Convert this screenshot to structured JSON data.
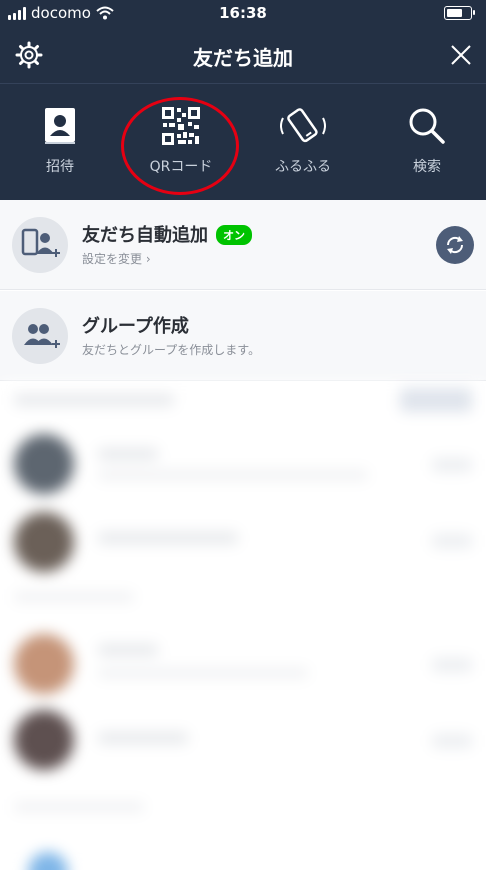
{
  "status_bar": {
    "carrier": "docomo",
    "time": "16:38"
  },
  "header": {
    "title": "友だち追加"
  },
  "actions": [
    {
      "label": "招待",
      "icon": "invite-contact-icon"
    },
    {
      "label": "QRコード",
      "icon": "qr-code-icon"
    },
    {
      "label": "ふるふる",
      "icon": "shake-phone-icon"
    },
    {
      "label": "検索",
      "icon": "search-icon"
    }
  ],
  "auto_add": {
    "title": "友だち自動追加",
    "badge": "オン",
    "subtitle": "設定を変更 ›"
  },
  "group": {
    "title": "グループ作成",
    "subtitle": "友だちとグループを作成します。"
  },
  "colors": {
    "header_bg": "#233044",
    "highlight_circle": "#e60012",
    "badge_green": "#00c300"
  }
}
